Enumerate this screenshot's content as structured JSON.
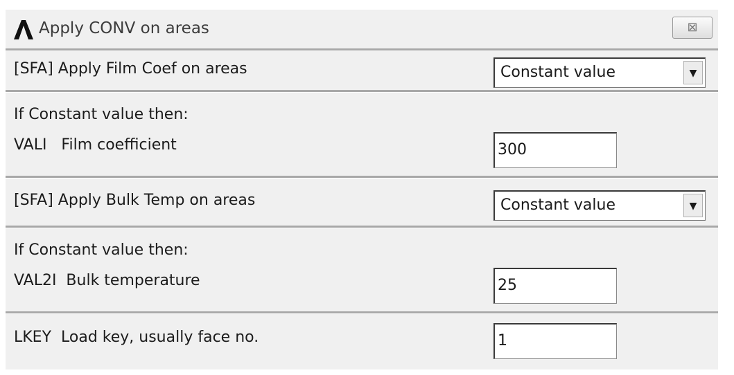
{
  "window": {
    "title": "Apply CONV on areas",
    "close_glyph": "⊠",
    "logo_icon": "ansys-logo-icon"
  },
  "sections": {
    "film_apply": {
      "label": "[SFA] Apply Film Coef on areas",
      "selected": "Constant value",
      "arrow": "▼"
    },
    "film_const": {
      "heading": "If Constant value then:",
      "label": "VALI   Film coefficient",
      "value": "300"
    },
    "bulk_apply": {
      "label": "[SFA] Apply Bulk Temp on areas",
      "selected": "Constant value",
      "arrow": "▼"
    },
    "bulk_const": {
      "heading": "If Constant value then:",
      "label": "VAL2I  Bulk temperature",
      "value": "25"
    },
    "lkey": {
      "label": "LKEY  Load key, usually face no.",
      "value": "1"
    }
  }
}
